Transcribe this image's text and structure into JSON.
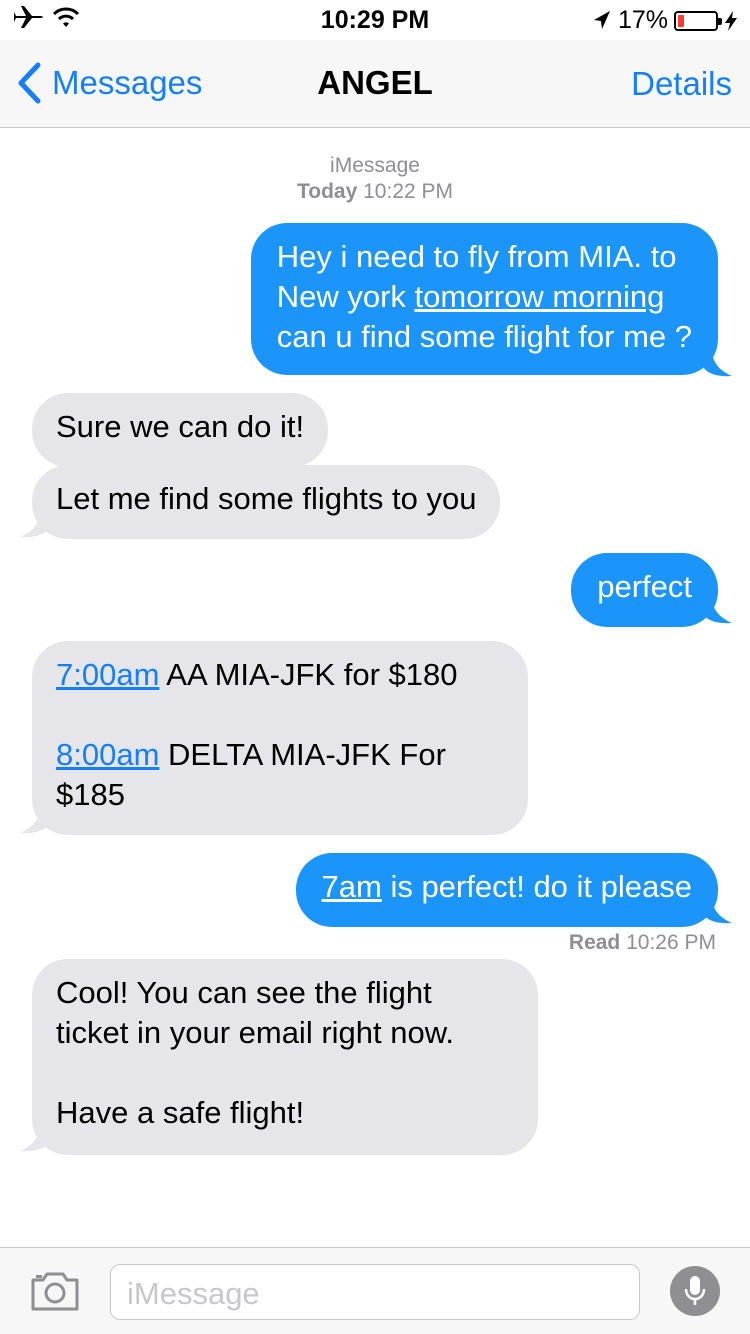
{
  "status_bar": {
    "time": "10:29 PM",
    "battery_text": "17%",
    "battery_level": 0.17,
    "icons": [
      "airplane-icon",
      "wifi-icon",
      "location-arrow-icon",
      "battery-icon",
      "charging-bolt-icon"
    ]
  },
  "nav": {
    "back_label": "Messages",
    "title": "ANGEL",
    "details_label": "Details"
  },
  "thread": {
    "service": "iMessage",
    "date_bold": "Today",
    "date_time": "10:22 PM",
    "messages": [
      {
        "side": "sent",
        "lines": {
          "l1": "Hey i need to fly from MIA. to",
          "l2_pre": "New york ",
          "l2_link": "tomorrow morning",
          "l3": "can u find some flight for me ?"
        }
      },
      {
        "side": "received",
        "text": "Sure we can do it!"
      },
      {
        "side": "received",
        "text": "Let me find some flights to you"
      },
      {
        "side": "sent",
        "text": "perfect"
      },
      {
        "side": "received",
        "f1_link": "7:00am",
        "f1_text": " AA MIA-JFK for $180",
        "f2_link": "8:00am",
        "f2_text": " DELTA MIA-JFK For",
        "f2_line2": "$185"
      },
      {
        "side": "sent",
        "link": "7am",
        "text": " is perfect! do it please"
      },
      {
        "side": "received",
        "l1": "Cool! You can see the flight",
        "l2": "ticket in your email right now.",
        "l3": "Have a safe flight!"
      }
    ],
    "read_bold": "Read",
    "read_time": "10:26 PM"
  },
  "input": {
    "placeholder": "iMessage"
  },
  "colors": {
    "accent": "#157efb",
    "sent_bubble": "#1b95f9",
    "received_bubble": "#e5e5ea",
    "meta_text": "#8e8e93",
    "battery_low": "#ff3b30"
  }
}
